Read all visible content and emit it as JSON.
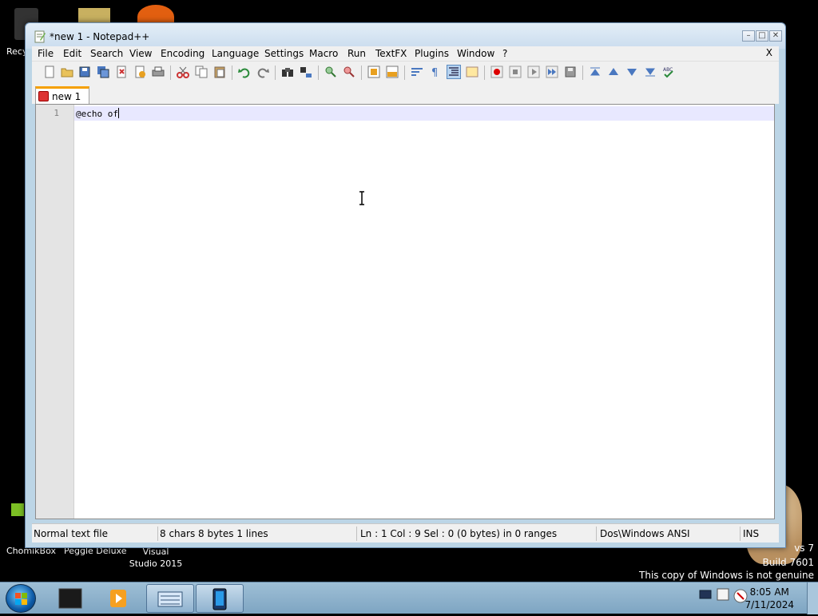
{
  "desktop": {
    "icons": [
      {
        "label": "Recy"
      },
      {
        "label": "ChomikBox"
      },
      {
        "label": "Peggle Deluxe"
      },
      {
        "label": "Visual Studio 2015"
      }
    ],
    "watermark": {
      "line1": "vs 7",
      "line2": "Build 7601",
      "line3": "This copy of Windows is not genuine"
    }
  },
  "window": {
    "title": "*new 1 - Notepad++",
    "controls": {
      "minimize": "–",
      "maximize": "□",
      "close": "✕"
    }
  },
  "menu": {
    "items": [
      "File",
      "Edit",
      "Search",
      "View",
      "Encoding",
      "Language",
      "Settings",
      "Macro",
      "Run",
      "TextFX",
      "Plugins",
      "Window",
      "?"
    ],
    "close": "X"
  },
  "toolbar": {
    "icons": [
      "new-file-icon",
      "open-file-icon",
      "save-icon",
      "save-all-icon",
      "close-icon",
      "close-all-icon",
      "print-icon",
      "cut-icon",
      "copy-icon",
      "paste-icon",
      "undo-icon",
      "redo-icon",
      "find-icon",
      "replace-icon",
      "zoom-in-icon",
      "zoom-out-icon",
      "sync-vertical-icon",
      "sync-horizontal-icon",
      "word-wrap-icon",
      "show-all-chars-icon",
      "indent-guide-icon",
      "user-lang-icon",
      "record-macro-icon",
      "stop-macro-icon",
      "play-macro-icon",
      "run-multiple-macro-icon",
      "save-macro-icon",
      "fold-all-icon",
      "prev-icon",
      "next-icon",
      "unfold-all-icon",
      "spellcheck-icon"
    ]
  },
  "tabs": [
    {
      "label": "new 1"
    }
  ],
  "editor": {
    "lines": [
      {
        "number": "1",
        "text": "@echo of"
      }
    ]
  },
  "status": {
    "doc_type": "Normal text file",
    "length": "8 chars   8 bytes   1 lines",
    "position": "Ln : 1    Col : 9    Sel : 0 (0 bytes) in 0 ranges",
    "eol_encoding": "Dos\\Windows  ANSI",
    "mode": "INS"
  },
  "taskbar": {
    "time": "8:05 AM",
    "date": "7/11/2024"
  }
}
